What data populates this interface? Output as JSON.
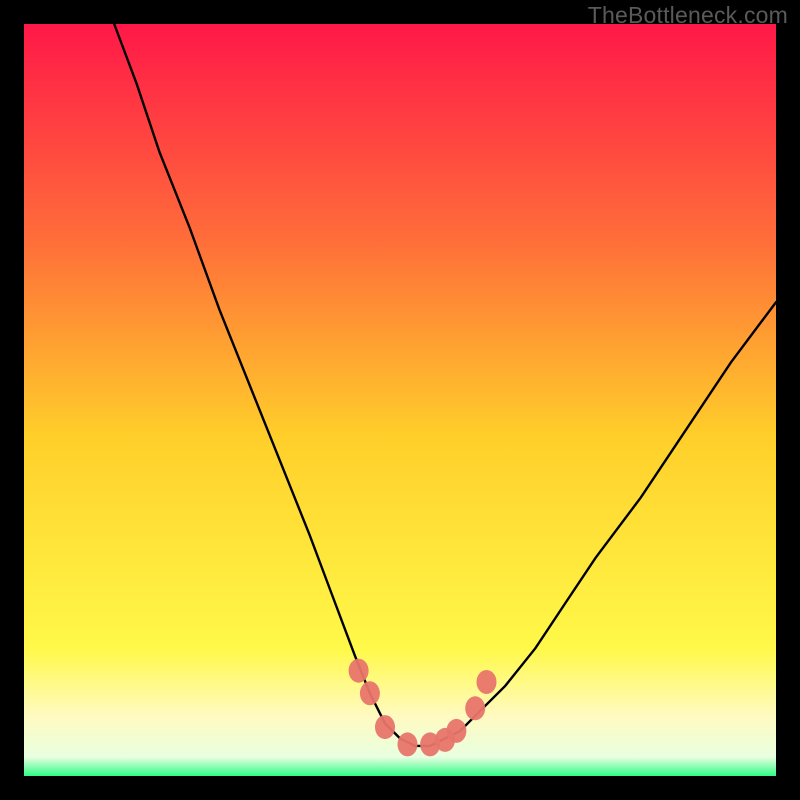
{
  "watermark": "TheBottleneck.com",
  "colors": {
    "black": "#000000",
    "curve": "#000000",
    "marker_fill": "#e8756a",
    "marker_stroke": "#d1574d",
    "grad_top": "#ff1848",
    "grad_mid_high": "#ff6b3a",
    "grad_mid": "#ffcf2a",
    "grad_low_yellow": "#fff949",
    "grad_pale": "#fffac0",
    "grad_green": "#2efb86"
  },
  "chart_data": {
    "type": "line",
    "title": "",
    "xlabel": "",
    "ylabel": "",
    "xlim": [
      0,
      100
    ],
    "ylim": [
      0,
      100
    ],
    "series": [
      {
        "name": "bottleneck-curve",
        "x": [
          12,
          15,
          18,
          22,
          26,
          30,
          34,
          38,
          41,
          44,
          46,
          48,
          50,
          52,
          54,
          56,
          58,
          60,
          64,
          68,
          72,
          76,
          82,
          88,
          94,
          100
        ],
        "y": [
          100,
          92,
          83,
          73,
          62,
          52,
          42,
          32,
          24,
          16,
          11,
          7,
          5,
          4,
          4,
          5,
          6,
          8,
          12,
          17,
          23,
          29,
          37,
          46,
          55,
          63
        ]
      }
    ],
    "markers": {
      "name": "highlighted-points",
      "x": [
        44.5,
        46.0,
        48.0,
        51.0,
        54.0,
        56.0,
        57.5,
        60.0,
        61.5
      ],
      "y": [
        14.0,
        11.0,
        6.5,
        4.2,
        4.2,
        4.8,
        6.0,
        9.0,
        12.5
      ]
    }
  }
}
